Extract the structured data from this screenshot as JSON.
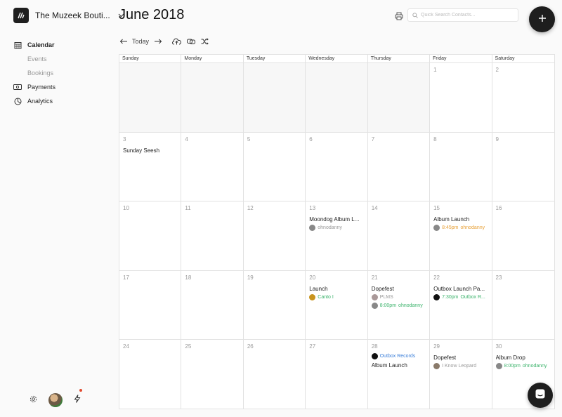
{
  "org": {
    "name": "The Muzeek Bouti..."
  },
  "nav": {
    "calendar": "Calendar",
    "events": "Events",
    "bookings": "Bookings",
    "payments": "Payments",
    "analytics": "Analytics"
  },
  "header": {
    "title": "June 2018",
    "today": "Today",
    "search_placeholder": "Quick Search Contacts..."
  },
  "calendar": {
    "dow": [
      "Sunday",
      "Monday",
      "Tuesday",
      "Wednesday",
      "Thursday",
      "Friday",
      "Saturday"
    ],
    "weeks": [
      [
        "",
        "",
        "",
        "",
        "",
        "1",
        "2"
      ],
      [
        "3",
        "4",
        "5",
        "6",
        "7",
        "8",
        "9"
      ],
      [
        "10",
        "11",
        "12",
        "13",
        "14",
        "15",
        "16"
      ],
      [
        "17",
        "18",
        "19",
        "20",
        "21",
        "22",
        "23"
      ],
      [
        "24",
        "25",
        "26",
        "27",
        "28",
        "29",
        "30"
      ]
    ],
    "events": {
      "d3": {
        "title": "Sunday Seesh"
      },
      "d13": {
        "title": "Moondog Album L...",
        "meta": "ohnodanny",
        "meta_color": "#999999"
      },
      "d15": {
        "title": "Album Launch",
        "time": "8:45pm",
        "meta": "ohnodanny",
        "color": "#e8a23a"
      },
      "d20": {
        "title": "Launch",
        "meta": "Canto I",
        "color": "#3bb36b"
      },
      "d21": {
        "title": "Dopefest",
        "meta": "PLMS",
        "meta2_time": "8:00pm",
        "meta2": "ohnodanny",
        "color": "#999999",
        "color2": "#3bb36b"
      },
      "d22": {
        "title": "Outbox Launch Pa...",
        "time": "7:30pm",
        "meta": "Outbox R...",
        "color": "#3bb36b"
      },
      "d28": {
        "pre_meta": "Outbox Records",
        "title": "Album Launch",
        "color": "#3b7fd9"
      },
      "d29": {
        "title": "Dopefest",
        "meta": "I Know Leopard",
        "color": "#999999"
      },
      "d30": {
        "title": "Album Drop",
        "time": "8:00pm",
        "meta": "ohnodanny",
        "color": "#3bb36b"
      }
    }
  }
}
